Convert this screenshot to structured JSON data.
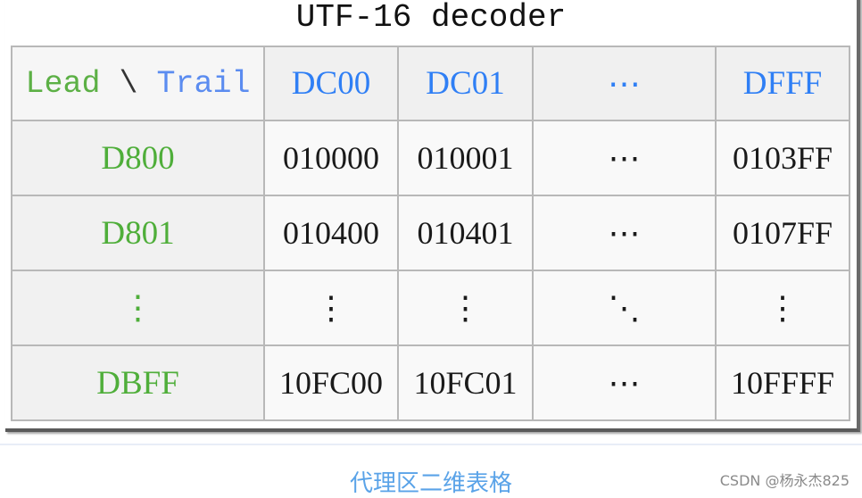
{
  "figure": {
    "title": "UTF-16 decoder",
    "corner_header": {
      "lead_label": "Lead",
      "separator": " \\ ",
      "trail_label": "Trail"
    },
    "trail_headers": [
      "DC00",
      "DC01",
      "⋯",
      "DFFF"
    ],
    "rows": [
      {
        "lead": "D800",
        "values": [
          "010000",
          "010001",
          "⋯",
          "0103FF"
        ]
      },
      {
        "lead": "D801",
        "values": [
          "010400",
          "010401",
          "⋯",
          "0107FF"
        ]
      },
      {
        "lead": "⋮",
        "values": [
          "⋮",
          "⋮",
          "⋱",
          "⋮"
        ]
      },
      {
        "lead": "DBFF",
        "values": [
          "10FC00",
          "10FC01",
          "⋯",
          "10FFFF"
        ]
      }
    ],
    "colors": {
      "lead": "#4fae3a",
      "trail": "#2f7ff5",
      "value": "#1a1a1a",
      "grid": "#b8b8b8"
    }
  },
  "caption": "代理区二维表格",
  "watermark": "CSDN @杨永杰825"
}
